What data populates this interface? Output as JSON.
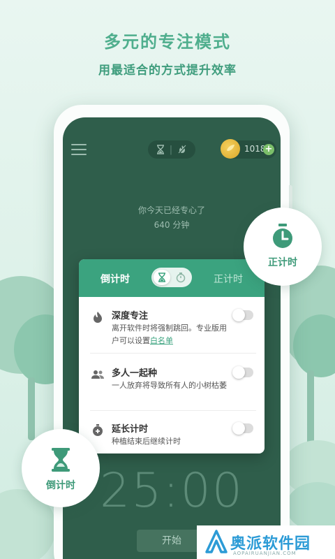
{
  "header": {
    "headline": "多元的专注模式",
    "subline": "用最适合的方式提升效率"
  },
  "top_bar": {
    "mode_icons": [
      "hourglass-icon",
      "no-fire-icon"
    ],
    "coins": "1018",
    "coin_plus": "+"
  },
  "focus_summary": {
    "line1": "你今天已经专心了",
    "line2": "640 分钟"
  },
  "popup": {
    "tab_countdown": "倒计时",
    "tab_countup": "正计时",
    "options": [
      {
        "title": "深度专注",
        "desc": "离开软件时将强制跳回。专业版用户可以设置",
        "link": "白名单",
        "enabled": false
      },
      {
        "title": "多人一起种",
        "desc": "一人放弃将导致所有人的小树枯萎",
        "enabled": false
      },
      {
        "title": "延长计时",
        "desc": "种植结束后继续计时",
        "enabled": false
      }
    ]
  },
  "timer": {
    "display": "25:00",
    "start_label": "开始"
  },
  "badges": {
    "countup_label": "正计时",
    "countdown_label": "倒计时"
  },
  "watermark": {
    "text": "奥派软件园",
    "sub": "AOPAIRUANJIAN.COM"
  },
  "colors": {
    "accent": "#3ba37f",
    "screen_bg": "#2f5e4b",
    "headline": "#4fae8d",
    "coin": "#e2b23a"
  }
}
